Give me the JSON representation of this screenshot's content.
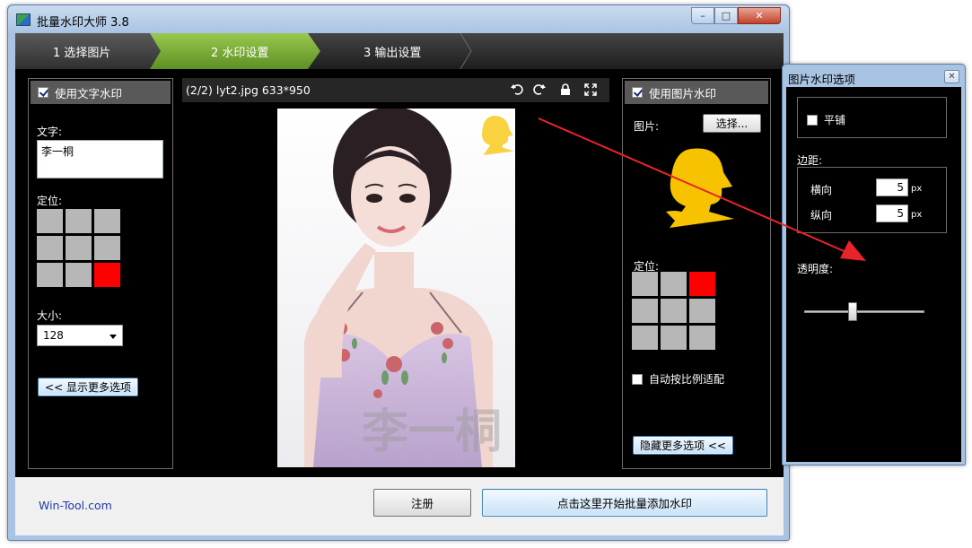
{
  "main_window": {
    "title": "批量水印大师 3.8",
    "controls": {
      "minimize": "–",
      "maximize": "□",
      "close": "✕"
    }
  },
  "steps": [
    {
      "label": "1 选择图片",
      "active": false
    },
    {
      "label": "2 水印设置",
      "active": true
    },
    {
      "label": "3 输出设置",
      "active": false
    }
  ],
  "text_watermark": {
    "enabled_label": "使用文字水印",
    "enabled": true,
    "text_label": "文字:",
    "text_value": "李一桐",
    "position_label": "定位:",
    "position_selected": 8,
    "size_label": "大小:",
    "size_value": "128",
    "more_button": "<< 显示更多选项"
  },
  "preview": {
    "title": "(2/2) lyt2.jpg 633*950",
    "icons": [
      "rotate-left-icon",
      "rotate-right-icon",
      "lock-icon",
      "fullscreen-icon"
    ],
    "watermark_text": "李一桐"
  },
  "image_watermark": {
    "enabled_label": "使用图片水印",
    "enabled": true,
    "image_label": "图片:",
    "choose_button": "选择...",
    "position_label": "定位:",
    "position_selected": 2,
    "auto_fit_label": "自动按比例适配",
    "auto_fit": false,
    "less_button": "隐藏更多选项 <<",
    "logo_color": "#f7c300"
  },
  "footer": {
    "link": "Win-Tool.com",
    "register_button": "注册",
    "start_button": "点击这里开始批量添加水印"
  },
  "options_window": {
    "title": "图片水印选项",
    "close": "✕",
    "tile_label": "平铺",
    "tile": false,
    "margin_label": "边距:",
    "horizontal_label": "横向",
    "horizontal_value": "5",
    "vertical_label": "纵向",
    "vertical_value": "5",
    "unit": "px",
    "opacity_label": "透明度:",
    "opacity_value": 0.4
  },
  "colors": {
    "accent_step": "#7db33a",
    "selected_cell": "#ff0000",
    "annotation_arrow": "#e8242a"
  }
}
